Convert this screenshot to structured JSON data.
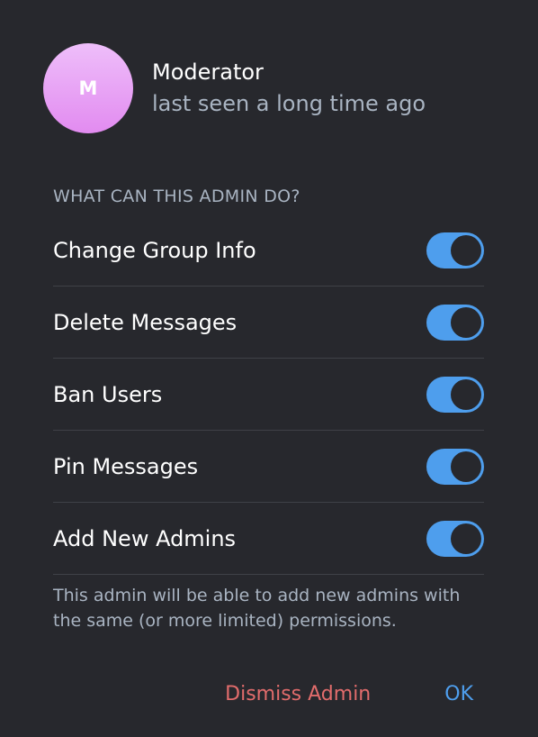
{
  "user": {
    "avatar_letter": "M",
    "name": "Moderator",
    "status": "last seen a long time ago"
  },
  "section_title": "WHAT CAN THIS ADMIN DO?",
  "permissions": [
    {
      "label": "Change Group Info",
      "enabled": true
    },
    {
      "label": "Delete Messages",
      "enabled": true
    },
    {
      "label": "Ban Users",
      "enabled": true
    },
    {
      "label": "Pin Messages",
      "enabled": true
    },
    {
      "label": "Add New Admins",
      "enabled": true
    }
  ],
  "note": "This admin will be able to add new admins with the same (or more limited) permissions.",
  "actions": {
    "dismiss_label": "Dismiss Admin",
    "ok_label": "OK"
  },
  "colors": {
    "background": "#27282d",
    "accent": "#4e9eed",
    "danger": "#e26c6c",
    "secondary_text": "#a9b4c2",
    "divider": "#3f4147"
  }
}
